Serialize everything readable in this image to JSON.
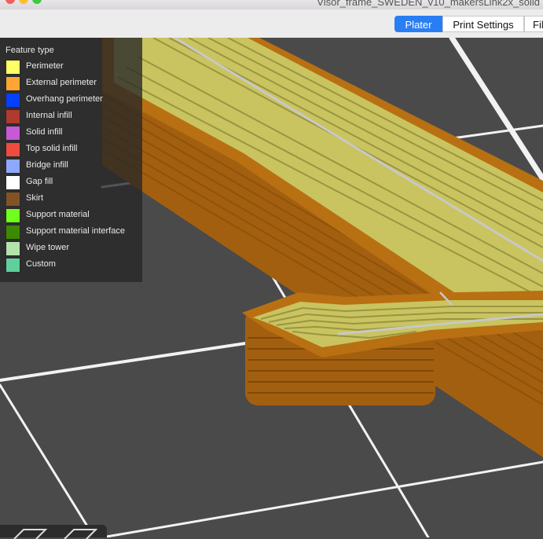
{
  "window": {
    "title": "Visor_frame_SWEDEN_v10_makersLink2x_solid"
  },
  "tabs": [
    {
      "label": "Plater",
      "active": true
    },
    {
      "label": "Print Settings",
      "active": false
    },
    {
      "label": "Fil",
      "active": false
    }
  ],
  "legend": {
    "title": "Feature type",
    "items": [
      {
        "label": "Perimeter",
        "color": "#ffff66"
      },
      {
        "label": "External perimeter",
        "color": "#ffa533"
      },
      {
        "label": "Overhang perimeter",
        "color": "#0540ff"
      },
      {
        "label": "Internal infill",
        "color": "#b03a2e"
      },
      {
        "label": "Solid infill",
        "color": "#c659d6"
      },
      {
        "label": "Top solid infill",
        "color": "#f04b3f"
      },
      {
        "label": "Bridge infill",
        "color": "#8fa8ff"
      },
      {
        "label": "Gap fill",
        "color": "#ffffff"
      },
      {
        "label": "Skirt",
        "color": "#845324"
      },
      {
        "label": "Support material",
        "color": "#6fff1a"
      },
      {
        "label": "Support material interface",
        "color": "#3c8a00"
      },
      {
        "label": "Wipe tower",
        "color": "#b3e3ab"
      },
      {
        "label": "Custom",
        "color": "#5fd09b"
      }
    ]
  },
  "colors": {
    "bed": "#4a4a4a",
    "grid": "#f2f2f2",
    "perimeter": "#c9c460",
    "external_perimeter": "#b87012",
    "gap_fill": "#c8c8c8",
    "accent": "#2a7ef3"
  }
}
